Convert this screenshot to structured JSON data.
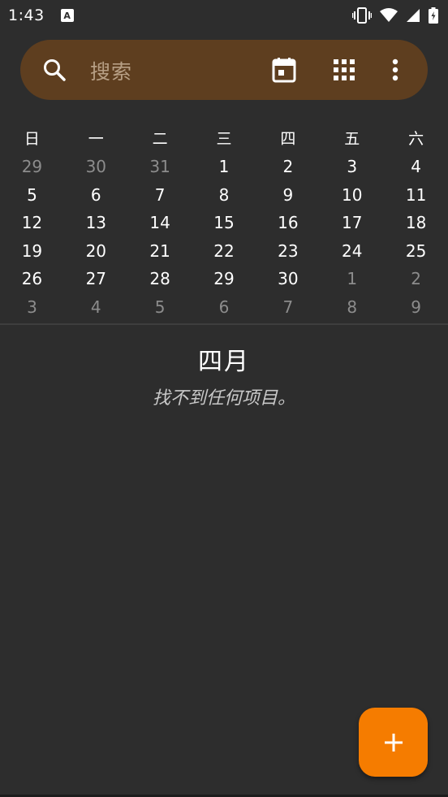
{
  "status_bar": {
    "time": "1:43",
    "notification_letter": "A"
  },
  "search": {
    "placeholder": "搜索"
  },
  "toolbar": {
    "icons": [
      "calendar-today-icon",
      "grid-view-icon",
      "more-vertical-icon"
    ]
  },
  "calendar": {
    "weekdays": [
      "日",
      "一",
      "二",
      "三",
      "四",
      "五",
      "六"
    ],
    "weeks": [
      [
        {
          "d": "29",
          "m": true
        },
        {
          "d": "30",
          "m": true
        },
        {
          "d": "31",
          "m": true
        },
        {
          "d": "1",
          "m": false
        },
        {
          "d": "2",
          "m": false
        },
        {
          "d": "3",
          "m": false
        },
        {
          "d": "4",
          "m": false
        }
      ],
      [
        {
          "d": "5",
          "m": false
        },
        {
          "d": "6",
          "m": false
        },
        {
          "d": "7",
          "m": false
        },
        {
          "d": "8",
          "m": false
        },
        {
          "d": "9",
          "m": false
        },
        {
          "d": "10",
          "m": false
        },
        {
          "d": "11",
          "m": false
        }
      ],
      [
        {
          "d": "12",
          "m": false
        },
        {
          "d": "13",
          "m": false
        },
        {
          "d": "14",
          "m": false
        },
        {
          "d": "15",
          "m": false
        },
        {
          "d": "16",
          "m": false
        },
        {
          "d": "17",
          "m": false
        },
        {
          "d": "18",
          "m": false
        }
      ],
      [
        {
          "d": "19",
          "m": false
        },
        {
          "d": "20",
          "m": false
        },
        {
          "d": "21",
          "m": false
        },
        {
          "d": "22",
          "m": false
        },
        {
          "d": "23",
          "m": false
        },
        {
          "d": "24",
          "m": false
        },
        {
          "d": "25",
          "m": false
        }
      ],
      [
        {
          "d": "26",
          "m": false
        },
        {
          "d": "27",
          "m": false
        },
        {
          "d": "28",
          "m": false
        },
        {
          "d": "29",
          "m": false
        },
        {
          "d": "30",
          "m": false
        },
        {
          "d": "1",
          "m": true
        },
        {
          "d": "2",
          "m": true
        }
      ],
      [
        {
          "d": "3",
          "m": true
        },
        {
          "d": "4",
          "m": true
        },
        {
          "d": "5",
          "m": true
        },
        {
          "d": "6",
          "m": true
        },
        {
          "d": "7",
          "m": true
        },
        {
          "d": "8",
          "m": true
        },
        {
          "d": "9",
          "m": true
        }
      ]
    ]
  },
  "agenda": {
    "month_title": "四月",
    "empty_message": "找不到任何项目。"
  },
  "fab": {
    "icon": "plus-icon"
  },
  "colors": {
    "background": "#2d2d2d",
    "search_bar": "#5e3e1f",
    "accent": "#f57c00"
  }
}
